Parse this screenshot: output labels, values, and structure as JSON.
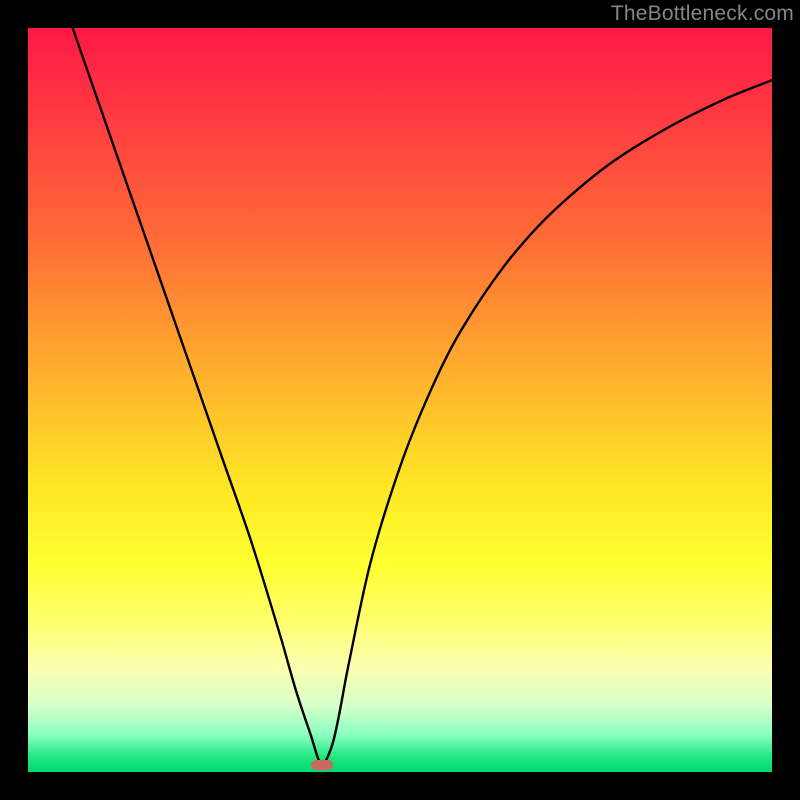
{
  "watermark": "TheBottleneck.com",
  "chart_data": {
    "type": "line",
    "title": "",
    "xlabel": "",
    "ylabel": "",
    "xlim": [
      0,
      1
    ],
    "ylim": [
      0,
      1
    ],
    "background_gradient": {
      "top": "#ff1846",
      "bottom": "#00d870"
    },
    "series": [
      {
        "name": "bottleneck-curve",
        "color": "#000000",
        "x": [
          0.06,
          0.1,
          0.14,
          0.18,
          0.22,
          0.26,
          0.3,
          0.34,
          0.36,
          0.38,
          0.395,
          0.41,
          0.43,
          0.46,
          0.5,
          0.54,
          0.58,
          0.64,
          0.7,
          0.78,
          0.86,
          0.94,
          1.0
        ],
        "values": [
          1.0,
          0.885,
          0.77,
          0.655,
          0.54,
          0.425,
          0.31,
          0.18,
          0.11,
          0.05,
          0.01,
          0.04,
          0.14,
          0.28,
          0.41,
          0.51,
          0.59,
          0.68,
          0.748,
          0.816,
          0.866,
          0.906,
          0.93
        ]
      }
    ],
    "marker": {
      "x": 0.395,
      "y": 0.01,
      "color": "#c96a5e"
    }
  }
}
